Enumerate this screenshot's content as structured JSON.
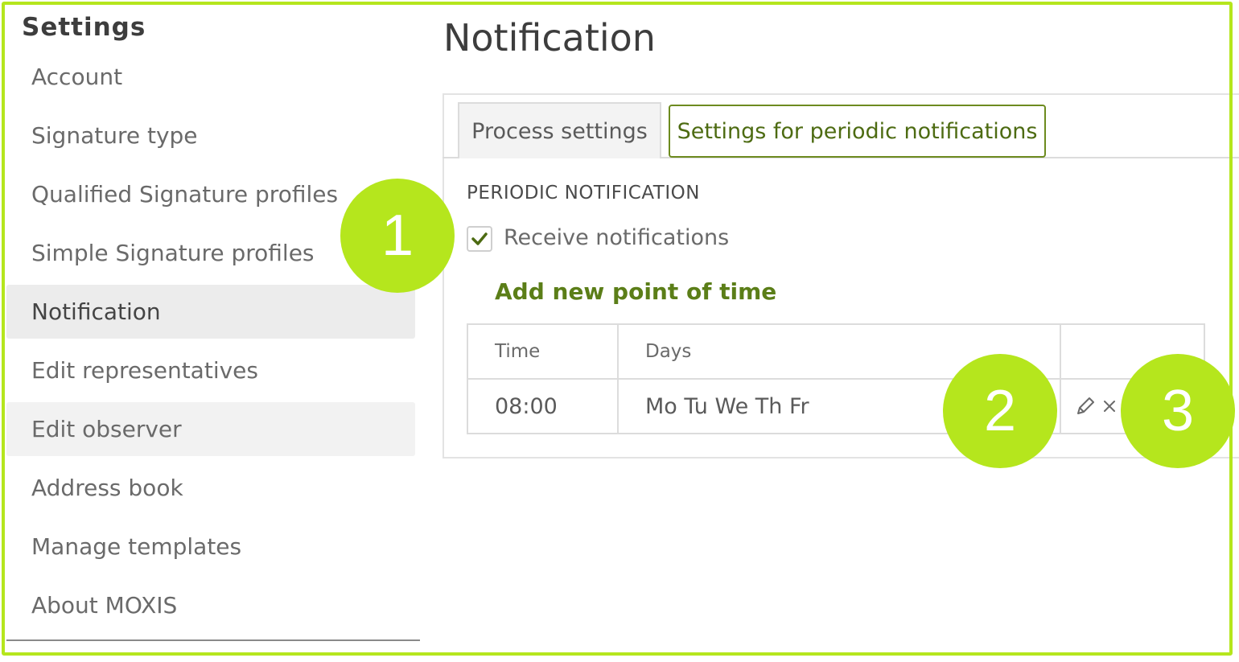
{
  "sidebar": {
    "title": "Settings",
    "items": [
      {
        "label": "Account"
      },
      {
        "label": "Signature type"
      },
      {
        "label": "Qualified Signature profiles"
      },
      {
        "label": "Simple Signature profiles"
      },
      {
        "label": "Notification"
      },
      {
        "label": "Edit representatives"
      },
      {
        "label": "Edit observer"
      },
      {
        "label": "Address book"
      },
      {
        "label": "Manage templates"
      },
      {
        "label": "About MOXIS"
      }
    ],
    "active_index": 4
  },
  "main": {
    "title": "Notification",
    "tabs": [
      {
        "label": "Process settings"
      },
      {
        "label": "Settings for periodic notifications"
      }
    ],
    "active_tab": 1,
    "section_heading": "PERIODIC NOTIFICATION",
    "receive_checkbox": {
      "label": "Receive notifications",
      "checked": true
    },
    "add_link": "Add new point of time",
    "table": {
      "headers": [
        "Time",
        "Days",
        ""
      ],
      "rows": [
        {
          "time": "08:00",
          "days": "Mo Tu We Th Fr"
        }
      ]
    }
  },
  "callouts": [
    "1",
    "2",
    "3"
  ],
  "colors": {
    "accent": "#b5e61d",
    "link_green": "#5b7e18",
    "tab_border": "#6d8b1f"
  },
  "icons": {
    "check": "check-icon",
    "edit": "pencil-icon",
    "delete": "close-icon"
  }
}
